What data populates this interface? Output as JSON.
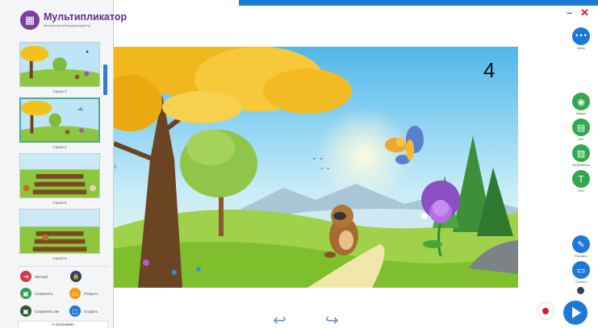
{
  "app": {
    "title": "Мультипликатор",
    "subtitle": "Интерактивный видеоредактор",
    "logo_icon": "film-icon"
  },
  "sidebar": {
    "scenes": [
      {
        "label": "Сцена 3",
        "active": false
      },
      {
        "label": "Сцена 4",
        "active": true
      },
      {
        "label": "Сцена 5",
        "active": false
      },
      {
        "label": "Сцена 6",
        "active": false
      }
    ],
    "buttons": {
      "export": {
        "label": "Экспорт",
        "icon": "export-icon",
        "color": "#d43b44"
      },
      "lock": {
        "label": "",
        "icon": "lock-icon",
        "color": "#2f3f5f"
      },
      "save": {
        "label": "Сохранить",
        "icon": "save-icon",
        "color": "#2da24c"
      },
      "open": {
        "label": "Открыть",
        "icon": "folder-icon",
        "color": "#f39a14"
      },
      "save_as": {
        "label": "Сохранить как",
        "icon": "save-as-icon",
        "color": "#2f5a3a"
      },
      "create": {
        "label": "Создать",
        "icon": "create-icon",
        "color": "#1e78d8"
      }
    },
    "about_label": "О программе"
  },
  "stage": {
    "frame_number": "4"
  },
  "toolbar": {
    "minimize": "–",
    "close": "✕",
    "menu": {
      "label": "Меню",
      "glyph": "•••",
      "color": "#1e78d8"
    },
    "camera": {
      "label": "Камера",
      "color": "#2fa84f"
    },
    "background": {
      "label": "Фон",
      "color": "#2fa84f"
    },
    "images": {
      "label": "Изображения",
      "color": "#2fa84f"
    },
    "text": {
      "label": "Текст",
      "glyph": "T",
      "color": "#2fa84f"
    },
    "paint": {
      "label": "Рисовать",
      "color": "#1e78d8"
    },
    "clear": {
      "label": "Очистить",
      "color": "#1e78d8"
    }
  },
  "playback": {
    "undo": "↩",
    "redo": "↪"
  },
  "colors": {
    "accent_blue": "#1e78d8",
    "accent_green": "#2fa84f",
    "brand_purple": "#6a2b8f"
  }
}
